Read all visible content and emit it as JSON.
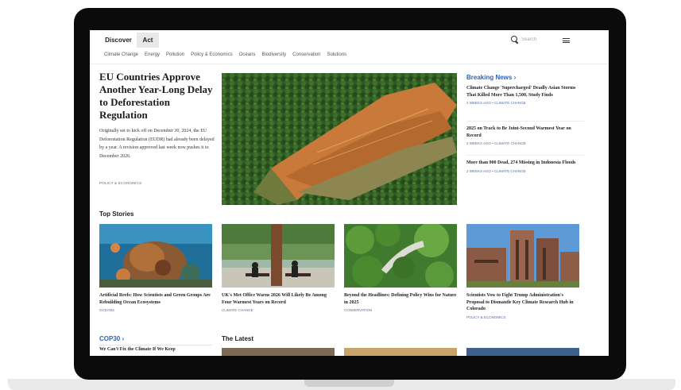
{
  "topnav": {
    "tabs": [
      {
        "label": "Discover"
      },
      {
        "label": "Act"
      }
    ],
    "search_placeholder": "Search"
  },
  "categories": [
    "Climate Change",
    "Energy",
    "Pollution",
    "Policy & Economics",
    "Oceans",
    "Biodiversity",
    "Conservation",
    "Solutions"
  ],
  "hero": {
    "title": "EU Countries Approve Another Year-Long Delay to Deforestation Regulation",
    "summary": "Originally set to kick off on December 30, 2024, the EU Deforestation Regulation (EUDR) had already been delayed by a year. A revision approved last week now pushes it to December 2026.",
    "tag": "POLICY & ECONOMICS"
  },
  "breaking_news": {
    "header": "Breaking News ›",
    "items": [
      {
        "title": "Climate Change 'Supercharged' Deadly Asian Storms That Killed More Than 1,500, Study Finds",
        "meta": "2 WEEKS AGO • CLIMATE CHANGE"
      },
      {
        "title": "2025 on Track to Be Joint-Second Warmest Year on Record",
        "meta": "2 WEEKS AGO • CLIMATE CHANGE"
      },
      {
        "title": "More than 900 Dead, 274 Missing in Indonesia Floods",
        "meta": "2 WEEKS AGO • CLIMATE CHANGE"
      }
    ]
  },
  "top_stories": {
    "header": "Top Stories",
    "items": [
      {
        "title": "Artificial Reefs: How Scientists and Green Groups Are Rebuilding Ocean Ecosystems",
        "tag": "OCEANS"
      },
      {
        "title": "UK's Met Office Warns 2026 Will Likely Be Among Four Warmest Years on Record",
        "tag": "CLIMATE CHANGE"
      },
      {
        "title": "Beyond the Headlines: Defining Policy Wins for Nature in 2025",
        "tag": "CONSERVATION"
      },
      {
        "title": "Scientists Vow to Fight Trump Administration's Proposal to Dismantle Key Climate Research Hub in Colorado",
        "tag": "POLICY & ECONOMICS"
      }
    ]
  },
  "cop30": {
    "header": "COP30 ›",
    "item": "We Can't Fix the Climate If We Keep"
  },
  "latest": {
    "header": "The Latest"
  }
}
